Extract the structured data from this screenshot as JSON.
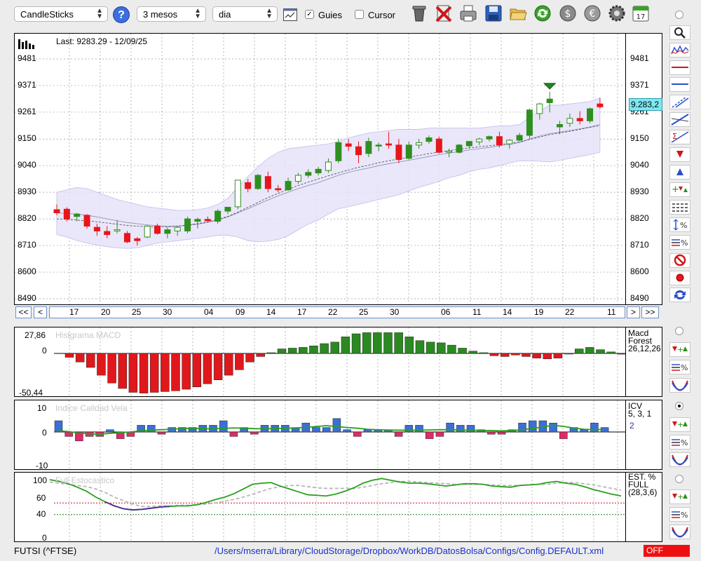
{
  "toolbar": {
    "chart_type": "CandleSticks",
    "period": "3 mesos",
    "interval": "dia",
    "guides_label": "Guies",
    "guides_checked": true,
    "cursor_label": "Cursor",
    "cursor_checked": false,
    "help_label": "?",
    "calendar_day": "17"
  },
  "price_panel": {
    "last_label": "Last: 9283.29 - 12/09/25",
    "price_badge": "9.283,2",
    "y_ticks": [
      "9481",
      "9371",
      "9261",
      "9150",
      "9040",
      "8930",
      "8820",
      "8710",
      "8600",
      "8490"
    ],
    "nav_labels": {
      "first": "<<",
      "prev": "<",
      "next": ">",
      "last": ">>"
    },
    "date_ticks": [
      "17",
      "20",
      "25",
      "30",
      "04",
      "09",
      "14",
      "17",
      "22",
      "25",
      "30",
      "06",
      "11",
      "14",
      "19",
      "22",
      "11"
    ]
  },
  "macd_panel": {
    "title": "Histgrama MACD",
    "y_ticks": [
      "27,86",
      "0",
      "-50,44"
    ],
    "info_lines": [
      "Macd",
      "Forest",
      "26,12,26"
    ]
  },
  "icv_panel": {
    "title": "Indice Calidad Vela",
    "y_ticks": [
      "10",
      "0",
      "-10"
    ],
    "info_lines": [
      "ICV",
      "5, 3, 1"
    ],
    "info_value": "2"
  },
  "est_panel": {
    "title": "Full Estocastico",
    "y_ticks": [
      "100",
      "60",
      "40",
      "0"
    ],
    "info_lines": [
      "EST. %",
      "FULL",
      "(28,3,6)"
    ]
  },
  "status": {
    "symbol": "FUTSI (^FTSE)",
    "path": "/Users/mserra/Library/CloudStorage/Dropbox/WorkDB/DatosBolsa/Configs/Config.DEFAULT.xml",
    "toggle": "OFF"
  },
  "colors": {
    "up": "#2f8f1f",
    "down": "#e8151b",
    "hist_up": "#2a8a20",
    "hist_down": "#e0181c",
    "icv_up": "#3a6fd8",
    "icv_down": "#e02a6a",
    "band": "#e6e3f8",
    "line_green": "#2aa01e"
  },
  "chart_data": [
    {
      "type": "candlestick",
      "title": "",
      "ylim": [
        8490,
        9481
      ],
      "candles": [
        {
          "o": 8858,
          "h": 8880,
          "l": 8835,
          "c": 8845
        },
        {
          "o": 8860,
          "h": 8868,
          "l": 8810,
          "c": 8820
        },
        {
          "o": 8830,
          "h": 8845,
          "l": 8810,
          "c": 8840
        },
        {
          "o": 8835,
          "h": 8840,
          "l": 8780,
          "c": 8790
        },
        {
          "o": 8785,
          "h": 8800,
          "l": 8750,
          "c": 8770
        },
        {
          "o": 8768,
          "h": 8790,
          "l": 8740,
          "c": 8755
        },
        {
          "o": 8770,
          "h": 8815,
          "l": 8760,
          "c": 8775
        },
        {
          "o": 8760,
          "h": 8770,
          "l": 8720,
          "c": 8725
        },
        {
          "o": 8738,
          "h": 8745,
          "l": 8710,
          "c": 8730
        },
        {
          "o": 8745,
          "h": 8795,
          "l": 8740,
          "c": 8790
        },
        {
          "o": 8790,
          "h": 8800,
          "l": 8755,
          "c": 8760
        },
        {
          "o": 8760,
          "h": 8785,
          "l": 8740,
          "c": 8775
        },
        {
          "o": 8770,
          "h": 8790,
          "l": 8750,
          "c": 8785
        },
        {
          "o": 8770,
          "h": 8830,
          "l": 8760,
          "c": 8820
        },
        {
          "o": 8810,
          "h": 8825,
          "l": 8780,
          "c": 8818
        },
        {
          "o": 8818,
          "h": 8830,
          "l": 8810,
          "c": 8812
        },
        {
          "o": 8810,
          "h": 8860,
          "l": 8800,
          "c": 8852
        },
        {
          "o": 8852,
          "h": 8870,
          "l": 8840,
          "c": 8868
        },
        {
          "o": 8870,
          "h": 8980,
          "l": 8860,
          "c": 8980
        },
        {
          "o": 8970,
          "h": 8985,
          "l": 8930,
          "c": 8945
        },
        {
          "o": 8945,
          "h": 9005,
          "l": 8940,
          "c": 9000
        },
        {
          "o": 8995,
          "h": 9015,
          "l": 8930,
          "c": 8945
        },
        {
          "o": 8945,
          "h": 8960,
          "l": 8930,
          "c": 8940
        },
        {
          "o": 8940,
          "h": 8990,
          "l": 8935,
          "c": 8975
        },
        {
          "o": 8975,
          "h": 9010,
          "l": 8965,
          "c": 9000
        },
        {
          "o": 9000,
          "h": 9025,
          "l": 8990,
          "c": 9012
        },
        {
          "o": 9010,
          "h": 9035,
          "l": 9000,
          "c": 9025
        },
        {
          "o": 9020,
          "h": 9070,
          "l": 9010,
          "c": 9055
        },
        {
          "o": 9060,
          "h": 9150,
          "l": 9050,
          "c": 9135
        },
        {
          "o": 9130,
          "h": 9150,
          "l": 9100,
          "c": 9120
        },
        {
          "o": 9118,
          "h": 9140,
          "l": 9050,
          "c": 9085
        },
        {
          "o": 9090,
          "h": 9155,
          "l": 9075,
          "c": 9140
        },
        {
          "o": 9125,
          "h": 9135,
          "l": 9100,
          "c": 9125
        },
        {
          "o": 9130,
          "h": 9180,
          "l": 9110,
          "c": 9125
        },
        {
          "o": 9125,
          "h": 9150,
          "l": 9050,
          "c": 9065
        },
        {
          "o": 9070,
          "h": 9140,
          "l": 9065,
          "c": 9125
        },
        {
          "o": 9125,
          "h": 9150,
          "l": 9110,
          "c": 9135
        },
        {
          "o": 9140,
          "h": 9165,
          "l": 9130,
          "c": 9155
        },
        {
          "o": 9150,
          "h": 9160,
          "l": 9090,
          "c": 9095
        },
        {
          "o": 9095,
          "h": 9110,
          "l": 9075,
          "c": 9100
        },
        {
          "o": 9095,
          "h": 9130,
          "l": 9090,
          "c": 9125
        },
        {
          "o": 9122,
          "h": 9140,
          "l": 9110,
          "c": 9140
        },
        {
          "o": 9138,
          "h": 9155,
          "l": 9125,
          "c": 9150
        },
        {
          "o": 9150,
          "h": 9165,
          "l": 9140,
          "c": 9160
        },
        {
          "o": 9160,
          "h": 9180,
          "l": 9115,
          "c": 9125
        },
        {
          "o": 9130,
          "h": 9150,
          "l": 9110,
          "c": 9145
        },
        {
          "o": 9145,
          "h": 9175,
          "l": 9140,
          "c": 9165
        },
        {
          "o": 9165,
          "h": 9275,
          "l": 9150,
          "c": 9270
        },
        {
          "o": 9255,
          "h": 9300,
          "l": 9230,
          "c": 9295
        },
        {
          "o": 9300,
          "h": 9345,
          "l": 9260,
          "c": 9315
        },
        {
          "o": 9200,
          "h": 9225,
          "l": 9170,
          "c": 9210
        },
        {
          "o": 9215,
          "h": 9255,
          "l": 9200,
          "c": 9235
        },
        {
          "o": 9235,
          "h": 9265,
          "l": 9210,
          "c": 9225
        },
        {
          "o": 9225,
          "h": 9280,
          "l": 9215,
          "c": 9275
        },
        {
          "o": 9295,
          "h": 9320,
          "l": 9275,
          "c": 9283
        }
      ],
      "bollinger_upper": [
        8930,
        8940,
        8950,
        8945,
        8930,
        8915,
        8900,
        8890,
        8880,
        8870,
        8865,
        8860,
        8855,
        8855,
        8858,
        8865,
        8880,
        8905,
        8950,
        8995,
        9035,
        9070,
        9095,
        9110,
        9115,
        9120,
        9125,
        9130,
        9140,
        9155,
        9165,
        9175,
        9180,
        9185,
        9190,
        9190,
        9190,
        9195,
        9195,
        9195,
        9195,
        9195,
        9195,
        9200,
        9205,
        9205,
        9210,
        9240,
        9265,
        9290,
        9290,
        9295,
        9300,
        9305,
        9320
      ],
      "bollinger_middle": [
        8845,
        8842,
        8840,
        8835,
        8828,
        8820,
        8812,
        8805,
        8800,
        8795,
        8792,
        8790,
        8790,
        8793,
        8798,
        8805,
        8815,
        8828,
        8845,
        8862,
        8880,
        8898,
        8915,
        8930,
        8945,
        8958,
        8970,
        8985,
        9000,
        9012,
        9022,
        9030,
        9040,
        9048,
        9055,
        9062,
        9070,
        9078,
        9085,
        9092,
        9098,
        9105,
        9110,
        9115,
        9122,
        9128,
        9135,
        9150,
        9162,
        9172,
        9178,
        9185,
        9192,
        9200,
        9210
      ],
      "bollinger_lower": [
        8755,
        8745,
        8730,
        8720,
        8712,
        8705,
        8700,
        8698,
        8700,
        8710,
        8720,
        8725,
        8730,
        8735,
        8740,
        8745,
        8752,
        8752,
        8745,
        8730,
        8725,
        8728,
        8735,
        8750,
        8775,
        8798,
        8815,
        8840,
        8862,
        8870,
        8880,
        8890,
        8900,
        8910,
        8920,
        8935,
        8950,
        8962,
        8975,
        8990,
        9000,
        9015,
        9025,
        9030,
        9040,
        9050,
        9060,
        9060,
        9058,
        9055,
        9062,
        9070,
        9078,
        9085,
        9095
      ],
      "sma": [
        8820,
        8818,
        8815,
        8812,
        8808,
        8803,
        8798,
        8793,
        8790,
        8788,
        8787,
        8787,
        8790,
        8795,
        8800,
        8808,
        8818,
        8830,
        8848,
        8868,
        8888,
        8908,
        8925,
        8942,
        8958,
        8972,
        8985,
        8998,
        9010,
        9022,
        9033,
        9042,
        9052,
        9060,
        9068,
        9075,
        9082,
        9090,
        9096,
        9102,
        9108,
        9113,
        9118,
        9122,
        9127,
        9132,
        9138,
        9148,
        9158,
        9168,
        9175,
        9182,
        9190,
        9198,
        9205
      ]
    },
    {
      "type": "bar",
      "title": "Histgrama MACD",
      "ylim": [
        -50.44,
        27.86
      ],
      "values": [
        -5,
        -11,
        -18,
        -28,
        -38,
        -45,
        -50,
        -51,
        -50,
        -49,
        -48,
        -46,
        -43,
        -39,
        -34,
        -28,
        -21,
        -11,
        -4,
        1,
        6,
        7,
        8,
        10,
        13,
        15,
        22,
        26,
        27.5,
        27.5,
        27.5,
        27.5,
        22,
        17,
        15,
        14,
        11,
        7,
        3,
        1,
        -3,
        -4,
        -2,
        -4,
        -6,
        -7,
        -6,
        0,
        6,
        8,
        5,
        2,
        -1
      ]
    },
    {
      "type": "bar",
      "title": "Indice Calidad Vela",
      "ylim": [
        -10,
        10
      ],
      "values": [
        5,
        -2,
        -4,
        -2,
        -2,
        1,
        -3,
        -2,
        3,
        3,
        -1,
        2,
        2,
        2,
        3,
        3,
        5,
        -2,
        2,
        -1,
        3,
        3,
        3,
        2,
        4,
        2,
        2,
        6,
        1,
        -2,
        1,
        1,
        1,
        -2,
        3,
        3,
        -3,
        -2,
        4,
        3,
        3,
        1,
        -1,
        -1,
        1,
        4,
        5,
        5,
        4,
        -3,
        2,
        1,
        4,
        2
      ],
      "signal": [
        0.5,
        0.2,
        -0.5,
        -0.8,
        -1,
        -0.6,
        -0.3,
        0,
        0.5,
        0.8,
        1,
        1.2,
        1.5,
        1.6,
        1.5,
        1.4,
        1.6,
        1.8,
        1.7,
        1.5,
        1.4,
        1.5,
        1.6,
        1.8,
        2,
        2.4,
        2.8,
        2.5,
        2,
        1.7,
        1.2,
        1,
        0.9,
        0.8,
        0.8,
        0.8,
        0.9,
        1,
        1,
        0.9,
        0.8,
        0.7,
        0.6,
        0.5,
        0.6,
        1,
        1.5,
        2.2,
        3,
        2.5,
        1.8,
        1.2,
        1,
        1.2
      ]
    },
    {
      "type": "line",
      "title": "Full Estocastico",
      "ylim": [
        0,
        100
      ],
      "series": [
        {
          "values": [
            100,
            97,
            93,
            87,
            80,
            70,
            62,
            55,
            50,
            48,
            49,
            51,
            53,
            54,
            55,
            55,
            57,
            61,
            66,
            70,
            76,
            84,
            92,
            94,
            95,
            89,
            84,
            79,
            74,
            73,
            72,
            75,
            80,
            86,
            94,
            99,
            102,
            99,
            96,
            94,
            94,
            93,
            91,
            89,
            91,
            93,
            93,
            92,
            89,
            88,
            87,
            90,
            91,
            92,
            95,
            97,
            94,
            92,
            88,
            83,
            79,
            75,
            72
          ]
        },
        {
          "values": [
            96,
            94,
            92,
            90,
            88,
            84,
            78,
            70,
            64,
            58,
            54,
            54,
            55,
            55,
            56,
            56,
            57,
            58,
            60,
            63,
            66,
            70,
            75,
            80,
            85,
            88,
            90,
            90,
            88,
            86,
            85,
            85,
            85,
            85,
            87,
            90,
            93,
            95,
            97,
            97,
            96,
            95,
            94,
            93,
            92,
            92,
            92,
            92,
            91,
            90,
            90,
            90,
            91,
            92,
            92,
            94,
            95,
            95,
            93,
            91,
            88,
            85,
            82
          ]
        }
      ]
    }
  ]
}
